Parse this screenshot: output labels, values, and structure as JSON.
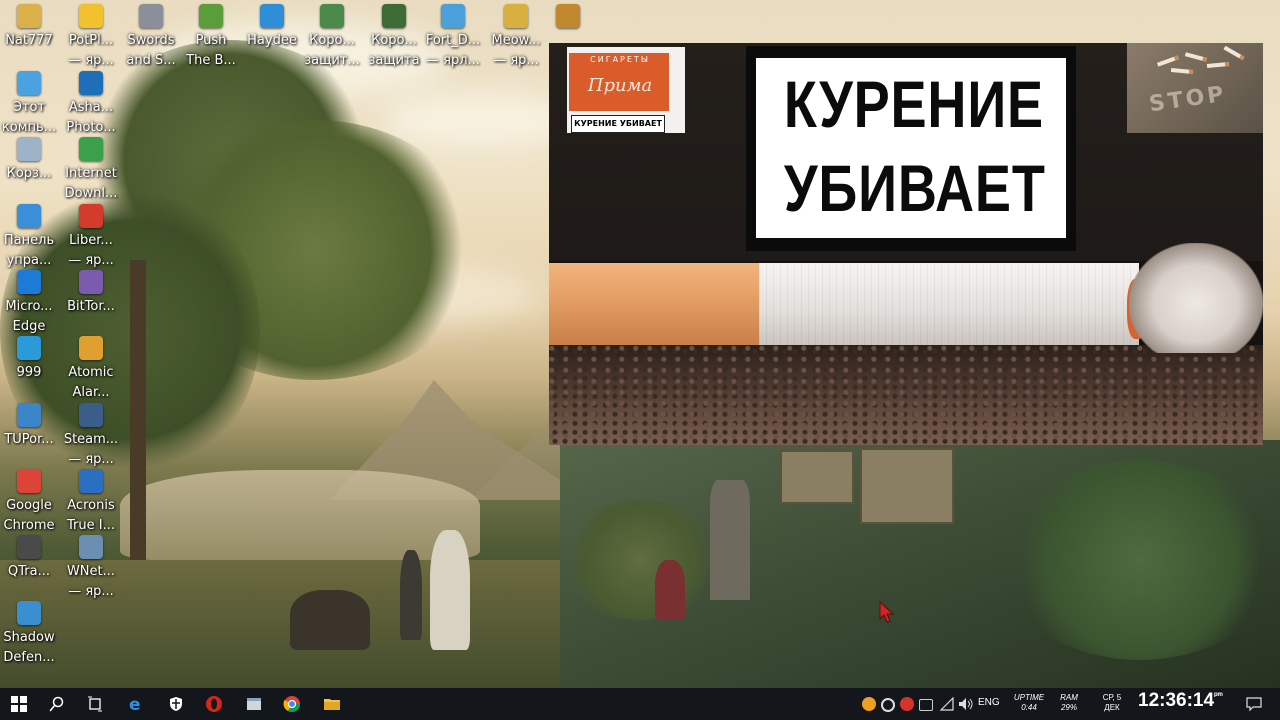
{
  "desktop_icons": [
    {
      "label": "Nat777",
      "icon": "crown-icon",
      "color": "#d9b04a"
    },
    {
      "label": "PotPl...\n— яр...",
      "icon": "potplayer-icon",
      "color": "#f2c12e"
    },
    {
      "label": "Swords\nand S...",
      "icon": "helmet-icon",
      "color": "#8a8f99"
    },
    {
      "label": "Push\nThe B...",
      "icon": "game-push-icon",
      "color": "#5a9e3a"
    },
    {
      "label": "Haydee",
      "icon": "haydee-icon",
      "color": "#2f8fd6"
    },
    {
      "label": "Коро...\nзащит...",
      "icon": "game-icon",
      "color": "#4b8a4b"
    },
    {
      "label": "Коро...\nзащита",
      "icon": "game-icon",
      "color": "#3d6b35"
    },
    {
      "label": "Fort_D...\n— ярл...",
      "icon": "fort-icon",
      "color": "#4aa0d8"
    },
    {
      "label": "Meow...\n— яр...",
      "icon": "cat-icon",
      "color": "#d8b040"
    },
    {
      "label": "",
      "icon": "game-icon",
      "color": "#c0892e"
    },
    {
      "label": "Этот\nкомпь...",
      "icon": "computer-icon",
      "color": "#4aa3e0"
    },
    {
      "label": "Asha...\nPhoto...",
      "icon": "aperture-icon",
      "color": "#1e6fb8"
    },
    {
      "label": "Корз...",
      "icon": "recycle-bin-icon",
      "color": "#9fb3c8"
    },
    {
      "label": "Internet\nDownl...",
      "icon": "idm-icon",
      "color": "#3aa04a"
    },
    {
      "label": "Панель\nупра...",
      "icon": "control-panel-icon",
      "color": "#3b8fd9"
    },
    {
      "label": "Liber...\n— яр...",
      "icon": "liberty-icon",
      "color": "#d43b2c"
    },
    {
      "label": "Micro...\nEdge",
      "icon": "edge-icon",
      "color": "#1d7bd8"
    },
    {
      "label": "BitTor...",
      "icon": "bittorrent-icon",
      "color": "#7a5bb0"
    },
    {
      "label": "999",
      "icon": "folder-icon",
      "color": "#2b9ad9"
    },
    {
      "label": "Atomic\nAlar...",
      "icon": "clock-icon",
      "color": "#e0a030"
    },
    {
      "label": "TUPor...",
      "icon": "window-icon",
      "color": "#3a86c9"
    },
    {
      "label": "Steam...\n— яр...",
      "icon": "steam-icon",
      "color": "#3a5d8a"
    },
    {
      "label": "Google\nChrome",
      "icon": "chrome-icon",
      "color": "#db4437"
    },
    {
      "label": "Acronis\nTrue I...",
      "icon": "acronis-icon",
      "color": "#2a6fc0"
    },
    {
      "label": "QTra...",
      "icon": "headset-icon",
      "color": "#4a4a4a"
    },
    {
      "label": "WNet...\n— яр...",
      "icon": "eye-icon",
      "color": "#6a8fb0"
    },
    {
      "label": "Shadow\nDefen...",
      "icon": "shield-icon",
      "color": "#3a8fd0"
    }
  ],
  "video": {
    "pack_brand_top": "СИГАРЕТЫ",
    "pack_brand": "Прима",
    "pack_warning": "КУРЕНИЕ УБИВАЕТ",
    "headline_line1": "КУРЕНИЕ",
    "headline_line2": "УБИВАЕТ",
    "stop_text": "STOP"
  },
  "taskbar": {
    "pinned": [
      {
        "name": "start-button",
        "icon": "windows-icon"
      },
      {
        "name": "search-button",
        "icon": "search-icon"
      },
      {
        "name": "task-view-button",
        "icon": "task-view-icon"
      },
      {
        "name": "edge-taskbar-button",
        "icon": "edge-icon"
      },
      {
        "name": "security-taskbar-button",
        "icon": "shield-icon"
      },
      {
        "name": "opera-taskbar-button",
        "icon": "opera-icon"
      },
      {
        "name": "window-taskbar-button",
        "icon": "window-icon"
      },
      {
        "name": "chrome-taskbar-button",
        "icon": "chrome-icon"
      },
      {
        "name": "explorer-taskbar-button",
        "icon": "folder-icon"
      }
    ],
    "tray": {
      "language": "ENG",
      "uptime_label": "UPTIME",
      "uptime_value": "0:44",
      "ram_label": "RAM",
      "ram_value": "29%",
      "date_line1": "СР, 5",
      "date_line2": "ДЕК",
      "time": "12:36:14",
      "time_suffix": "ᵖᵐ"
    }
  },
  "colors": {
    "taskbar_bg": "#13171c",
    "warning_bg": "#ffffff",
    "warning_text": "#0b0b0b",
    "pack_red": "#d95c2a"
  }
}
